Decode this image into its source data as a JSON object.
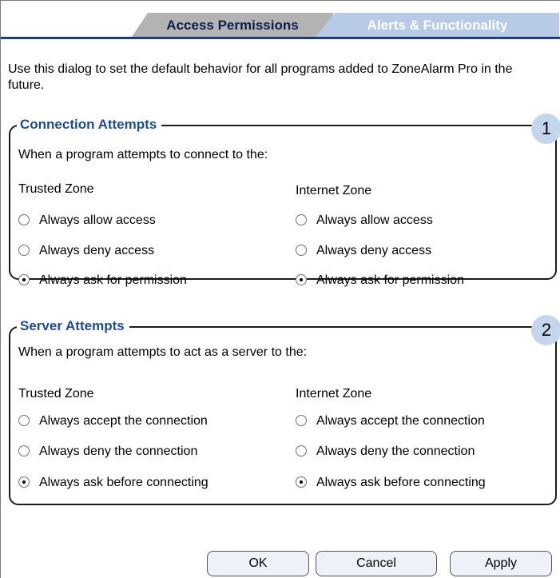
{
  "tabs": [
    {
      "label": "Access Permissions",
      "active": true
    },
    {
      "label": "Alerts & Functionality",
      "active": false
    }
  ],
  "intro": "Use this dialog to set the default behavior for all programs added to ZoneAlarm Pro in the future.",
  "connection": {
    "title": "Connection Attempts",
    "number": "1",
    "prompt": "When a program attempts to connect to the:",
    "trusted": {
      "label": "Trusted Zone",
      "options": [
        "Always allow access",
        "Always deny access",
        "Always ask for permission"
      ],
      "selected": 2
    },
    "internet": {
      "label": "Internet Zone",
      "options": [
        "Always allow access",
        "Always deny access",
        "Always ask for permission"
      ],
      "selected": 2
    }
  },
  "server": {
    "title": "Server Attempts",
    "number": "2",
    "prompt": "When a program attempts to act as a server to the:",
    "trusted": {
      "label": "Trusted Zone",
      "options": [
        "Always accept the connection",
        "Always deny the connection",
        "Always ask before connecting"
      ],
      "selected": 2
    },
    "internet": {
      "label": "Internet Zone",
      "options": [
        "Always accept the connection",
        "Always deny the connection",
        "Always ask before connecting"
      ],
      "selected": 2
    }
  },
  "buttons": {
    "ok": "OK",
    "cancel": "Cancel",
    "apply": "Apply"
  },
  "colors": {
    "accent": "#1f4d8c",
    "tab_active": "#b3b3b3",
    "tab_inactive": "#b7cbe6",
    "badge": "#c4d5ee"
  }
}
